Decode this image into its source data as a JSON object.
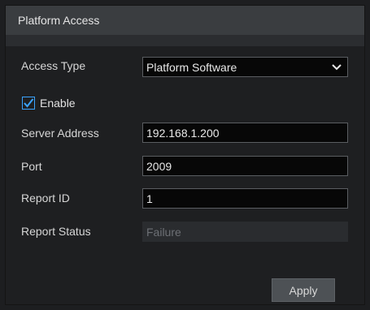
{
  "header": {
    "title": "Platform Access"
  },
  "form": {
    "access_type": {
      "label": "Access Type",
      "value": "Platform Software"
    },
    "enable": {
      "label": "Enable",
      "checked": true
    },
    "server_address": {
      "label": "Server Address",
      "value": "192.168.1.200"
    },
    "port": {
      "label": "Port",
      "value": "2009"
    },
    "report_id": {
      "label": "Report ID",
      "value": "1"
    },
    "report_status": {
      "label": "Report Status",
      "value": "Failure"
    }
  },
  "buttons": {
    "apply_label": "Apply"
  },
  "colors": {
    "accent": "#3ba3ff",
    "panel_bg": "#1e1f21",
    "title_bar": "#3a3d40",
    "field_bg": "#070707"
  },
  "icons": {
    "select_arrow": "chevron-down-icon",
    "check": "checkmark-icon"
  }
}
